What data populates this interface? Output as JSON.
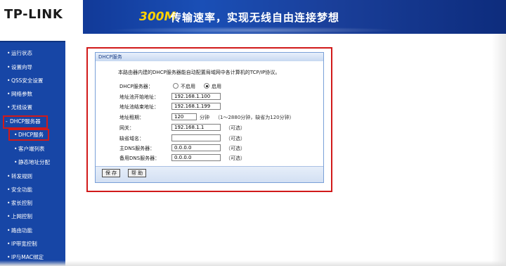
{
  "header": {
    "logo": "TP-LINK",
    "slogan_speed": "300M",
    "slogan_text": "传输速率，实现无线自由连接梦想"
  },
  "sidebar": {
    "items": [
      {
        "label": "运行状态"
      },
      {
        "label": "设置向导"
      },
      {
        "label": "QSS安全设置"
      },
      {
        "label": "网络参数"
      },
      {
        "label": "无线设置"
      },
      {
        "label": "DHCP服务器",
        "selected": true
      },
      {
        "label": "DHCP服务",
        "sub": true,
        "selected": true
      },
      {
        "label": "客户端列表",
        "sub": true
      },
      {
        "label": "静态地址分配",
        "sub": true
      },
      {
        "label": "转发规则"
      },
      {
        "label": "安全功能"
      },
      {
        "label": "家长控制"
      },
      {
        "label": "上网控制"
      },
      {
        "label": "路由功能"
      },
      {
        "label": "IP带宽控制"
      },
      {
        "label": "IP与MAC绑定"
      }
    ],
    "highlight_color": "#d11a1a"
  },
  "panel": {
    "title": "DHCP服务",
    "description": "本路由器内建的DHCP服务器能自动配置局域网中各计算机的TCP/IP协议。",
    "fields": {
      "dhcp_server": {
        "label": "DHCP服务器：",
        "options": [
          "不启用",
          "启用"
        ],
        "selected": "启用"
      },
      "start_ip": {
        "label": "地址池开始地址：",
        "value": "192.168.1.100"
      },
      "end_ip": {
        "label": "地址池结束地址：",
        "value": "192.168.1.199"
      },
      "lease": {
        "label": "地址租期：",
        "value": "120",
        "unit": "分钟",
        "hint": "（1～2880分钟，缺省为120分钟）"
      },
      "gateway": {
        "label": "网关：",
        "value": "192.168.1.1",
        "hint": "（可选）"
      },
      "domain": {
        "label": "缺省域名：",
        "value": "",
        "hint": "（可选）"
      },
      "dns_primary": {
        "label": "主DNS服务器：",
        "value": "0.0.0.0",
        "hint": "（可选）"
      },
      "dns_secondary": {
        "label": "备用DNS服务器：",
        "value": "0.0.0.0",
        "hint": "（可选）"
      }
    },
    "buttons": {
      "save": "保 存",
      "help": "帮 助"
    }
  },
  "colors": {
    "header_blue": "#123b9a",
    "sidebar_blue": "#1746a6",
    "slogan_yellow": "#ffd200",
    "highlight_red": "#d11a1a"
  }
}
